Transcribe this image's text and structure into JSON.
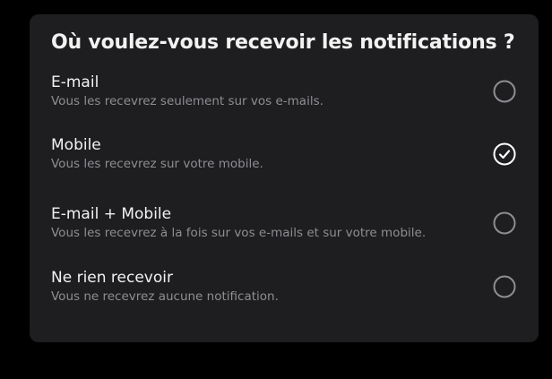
{
  "dialog": {
    "title": "Où voulez-vous recevoir les notifications ?"
  },
  "options": [
    {
      "title": "E-mail",
      "description": "Vous les recevrez seulement sur vos e-mails.",
      "selected": false
    },
    {
      "title": "Mobile",
      "description": "Vous les recevrez sur votre mobile.",
      "selected": true
    },
    {
      "title": "E-mail + Mobile",
      "description": "Vous les recevrez à la fois sur vos e-mails et sur votre mobile.",
      "selected": false
    },
    {
      "title": "Ne rien recevoir",
      "description": "Vous ne recevrez aucune notification.",
      "selected": false
    }
  ],
  "colors": {
    "background": "#000000",
    "panel": "#1e1e20",
    "text_primary": "#f2f2f2",
    "text_secondary": "#8e8e93",
    "radio_unselected": "#8e8e93",
    "radio_selected": "#ffffff"
  },
  "icons": {
    "unselected": "radio-empty-icon",
    "selected": "check-circle-icon"
  }
}
